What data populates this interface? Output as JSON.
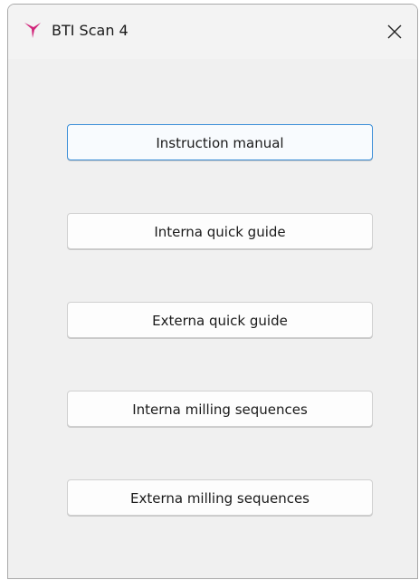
{
  "window": {
    "title": "BTI Scan 4",
    "icon": "hummingbird-logo-icon",
    "icon_color": "#d1257a",
    "close_icon": "close-icon"
  },
  "buttons": [
    {
      "label": "Instruction manual",
      "focused": true
    },
    {
      "label": "Interna quick guide",
      "focused": false
    },
    {
      "label": "Externa quick guide",
      "focused": false
    },
    {
      "label": "Interna milling sequences",
      "focused": false
    },
    {
      "label": "Externa milling sequences",
      "focused": false
    }
  ]
}
